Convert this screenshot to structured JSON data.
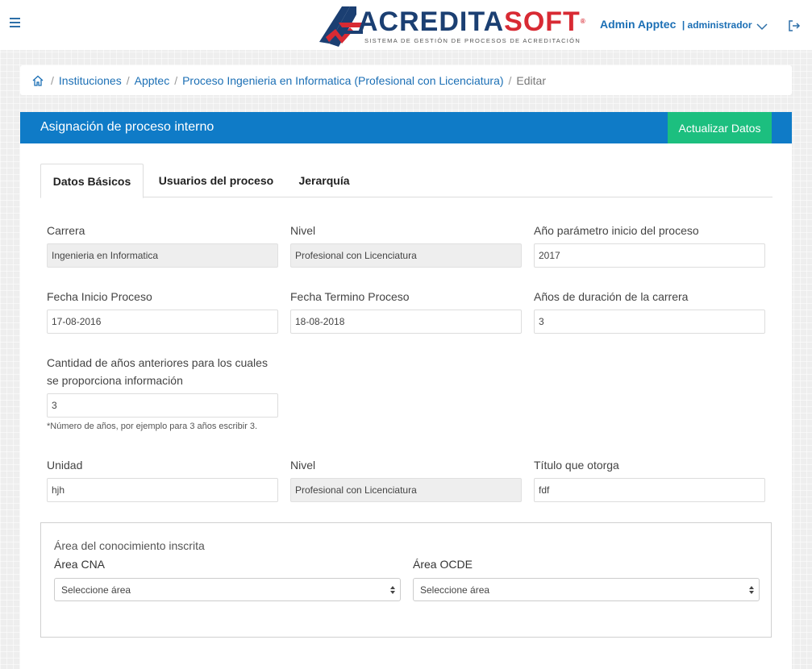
{
  "header": {
    "logo_part1": "ACREDITA",
    "logo_part2": "SOFT",
    "logo_reg": "®",
    "logo_subtitle": "SISTEMA DE GESTIÓN DE PROCESOS DE ACREDITACIÓN",
    "user_name": "Admin Apptec",
    "user_role": "| administrador",
    "icons": [
      "menu-icon",
      "chevron-down-icon",
      "logout-icon"
    ]
  },
  "breadcrumb": {
    "items": [
      {
        "label": "Instituciones"
      },
      {
        "label": "Apptec"
      },
      {
        "label": "Proceso Ingenieria en Informatica (Profesional con Licenciatura)"
      }
    ],
    "current": "Editar",
    "separator": "/"
  },
  "card": {
    "title": "Asignación de proceso interno",
    "update_label": "Actualizar Datos"
  },
  "tabs": [
    {
      "label": "Datos Básicos",
      "active": true
    },
    {
      "label": "Usuarios del proceso",
      "active": false
    },
    {
      "label": "Jerarquía",
      "active": false
    }
  ],
  "form": {
    "carrera": {
      "label": "Carrera",
      "value": "Ingenieria en Informatica"
    },
    "nivel": {
      "label": "Nivel",
      "value": "Profesional con Licenciatura"
    },
    "anio_param": {
      "label": "Año parámetro inicio del proceso",
      "value": "2017"
    },
    "fecha_inicio": {
      "label": "Fecha Inicio Proceso",
      "value": "17-08-2016"
    },
    "fecha_termino": {
      "label": "Fecha Termino Proceso",
      "value": "18-08-2018"
    },
    "anios_duracion": {
      "label": "Años de duración de la carrera",
      "value": "3"
    },
    "cantidad_anios": {
      "label_line1": "Cantidad de años anteriores para los cuales",
      "label_line2": "se proporciona información",
      "value": "3",
      "hint": "*Número de años, por ejemplo para 3 años escribir 3."
    },
    "unidad": {
      "label": "Unidad",
      "value": "hjh"
    },
    "nivel2": {
      "label": "Nivel",
      "value": "Profesional con Licenciatura"
    },
    "titulo": {
      "label": "Título que otorga",
      "value": "fdf"
    }
  },
  "area": {
    "title": "Área del conocimiento inscrita",
    "cna": {
      "label": "Área CNA",
      "selected": "Seleccione área"
    },
    "ocde": {
      "label": "Área OCDE",
      "selected": "Seleccione área"
    }
  },
  "colors": {
    "primary": "#0f7bc7",
    "success": "#1cbf7f",
    "link": "#1b6fb5",
    "logo_blue": "#1b3f72",
    "logo_red": "#d82a33"
  }
}
